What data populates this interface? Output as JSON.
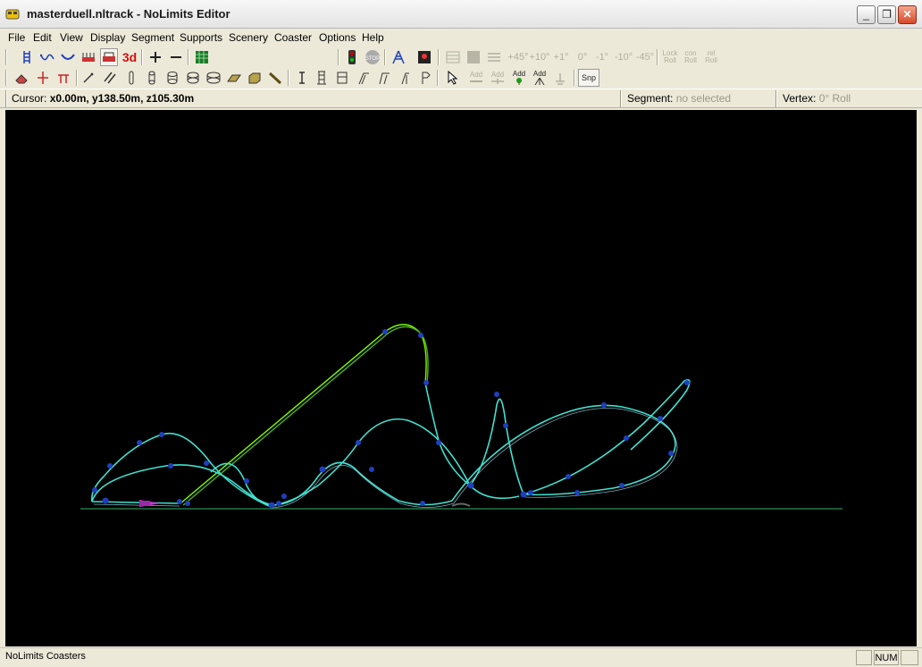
{
  "window": {
    "title": "masterduell.nltrack - NoLimits Editor"
  },
  "menu": [
    "File",
    "Edit",
    "View",
    "Display",
    "Segment",
    "Supports",
    "Scenery",
    "Coaster",
    "Options",
    "Help"
  ],
  "toolbar1": {
    "three_d_label": "3d",
    "stop_label": "STOP",
    "angle_labels": [
      "+45°",
      "+10°",
      "+1°",
      "0°",
      "-1°",
      "-10°",
      "-45°"
    ],
    "lock_label": [
      "Lock",
      "Roll"
    ],
    "con_label": [
      "con",
      "Roll"
    ],
    "rel_label": [
      "rel",
      "Roll"
    ]
  },
  "toolbar2": {
    "add_labels": [
      "Add",
      "Add",
      "Add",
      "Add"
    ],
    "snap_label": "Snp"
  },
  "info": {
    "cursor_label": "Cursor:",
    "cursor_value": "x0.00m, y138.50m, z105.30m",
    "segment_label": "Segment:",
    "segment_value": "no selected",
    "vertex_label": "Vertex:",
    "vertex_value": "0° Roll"
  },
  "status": {
    "text": "NoLimits Coasters",
    "num": "NUM"
  },
  "colors": {
    "track": "#40e0d0",
    "lift": "#7cfc00",
    "vertex": "#1f3fbf",
    "ground": "#2e8b57",
    "viewport_bg": "#000000"
  }
}
